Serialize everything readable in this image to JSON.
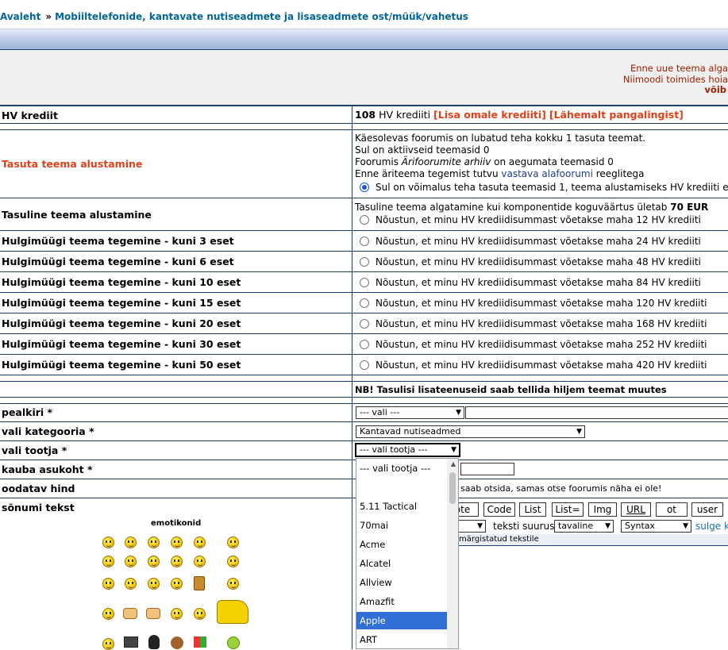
{
  "breadcrumb": {
    "home": "Avaleht",
    "separator": "»",
    "current": "Mobiiltelefonide, kantavate nutiseadmete ja lisaseadmete ost/müük/vahetus"
  },
  "notice": {
    "line1": "Enne uue teema alga",
    "line2": "Niimoodi toimides hoia",
    "line3": "võib"
  },
  "credit": {
    "label": "HV krediit",
    "amount": "108",
    "unit": "HV krediiti",
    "add_link": "[Lisa omale krediiti]",
    "bank_link": "[Lähemalt pangalingist]"
  },
  "free_topic": {
    "label": "Tasuta teema alustamine",
    "line1": "Käesolevas foorumis on lubatud teha kokku 1 tasuta teemat.",
    "line2": "Sul on aktiivseid teemasid 0",
    "line3_a": "Foorumis ",
    "line3_italic": "Ärifoorumite arhiiv",
    "line3_b": " on aegumata teemasid 0",
    "line4_a": "Enne äriteema tegemist tutvu ",
    "line4_link": "vastava alafoorumi",
    "line4_b": " reeglitega",
    "radio_text": "Sul on võimalus teha tasuta teemasid 1, teema alustamiseks HV krediiti e"
  },
  "paid_topic": {
    "label": "Tasuline teema alustamine",
    "line1_a": "Tasuline teema algatamine kui komponentide koguväärtus ületab ",
    "line1_b": "70 EUR",
    "radio_text": "Nõustun, et minu HV krediidisummast võetakse maha 12 HV krediiti"
  },
  "bulk_rows": [
    {
      "label": "Hulgimüügi teema tegemine - kuni 3 eset",
      "text": "Nõustun, et minu HV krediidisummast võetakse maha 24 HV krediiti"
    },
    {
      "label": "Hulgimüügi teema tegemine - kuni 6 eset",
      "text": "Nõustun, et minu HV krediidisummast võetakse maha 48 HV krediiti"
    },
    {
      "label": "Hulgimüügi teema tegemine - kuni 10 eset",
      "text": "Nõustun, et minu HV krediidisummast võetakse maha 84 HV krediiti"
    },
    {
      "label": "Hulgimüügi teema tegemine - kuni 15 eset",
      "text": "Nõustun, et minu HV krediidisummast võetakse maha 120 HV krediiti"
    },
    {
      "label": "Hulgimüügi teema tegemine - kuni 20 eset",
      "text": "Nõustun, et minu HV krediidisummast võetakse maha 168 HV krediiti"
    },
    {
      "label": "Hulgimüügi teema tegemine - kuni 30 eset",
      "text": "Nõustun, et minu HV krediidisummast võetakse maha 252 HV krediiti"
    },
    {
      "label": "Hulgimüügi teema tegemine - kuni 50 eset",
      "text": "Nõustun, et minu HV krediidisummast võetakse maha 420 HV krediiti"
    }
  ],
  "nb_note": "NB! Tasulisi lisateenuseid saab tellida hiljem teemat muutes",
  "form": {
    "title_label": "pealkiri *",
    "title_select": "--- vali ---",
    "category_label": "vali kategooria *",
    "category_select": "Kantavad nutiseadmed",
    "maker_label": "vali tootja *",
    "maker_select": "--- vali tootja ---",
    "location_label": "kauba asukoht *",
    "price_label": "oodatav hind",
    "price_note": "saab otsida, samas otse foorumis näha ei ole!",
    "message_label": "sõnumi tekst"
  },
  "editor": {
    "buttons": [
      "ote",
      "Code",
      "List",
      "List=",
      "Img",
      "URL",
      "ot",
      "user"
    ],
    "size_label": "teksti suurus:",
    "size_select": "tavaline",
    "syntax_select": "Syntax",
    "close_link": "sulge k",
    "hint": "ti, märgistatud tekstile"
  },
  "emoticons_title": "emotikonid",
  "maker_options": [
    "--- vali tootja ---",
    "5.11 Tactical",
    "70mai",
    "Acme",
    "Alcatel",
    "Allview",
    "Amazfit",
    "Apple",
    "ART"
  ],
  "maker_highlighted": "Apple",
  "emoticon_icons": [
    "grin-icon",
    "grin-icon",
    "frown-icon",
    "confused-icon",
    "smile-icon",
    "cool-icon",
    "grin-icon",
    "grin-icon",
    "tongue-icon",
    "laugh-icon",
    "smile-icon",
    "sad-icon",
    "evil-icon",
    "eek-icon",
    "smile-icon",
    "neutral-icon",
    "beer-icon",
    "question-icon",
    "exclaim-icon",
    "thumbs-up-icon",
    "thumbs-down-icon",
    "arrow-icon",
    "idea-icon",
    "digger-icon",
    "sleepy-icon",
    "computer-icon",
    "penguin-icon",
    "monkey-icon",
    "windows-icon",
    "green-icon"
  ]
}
